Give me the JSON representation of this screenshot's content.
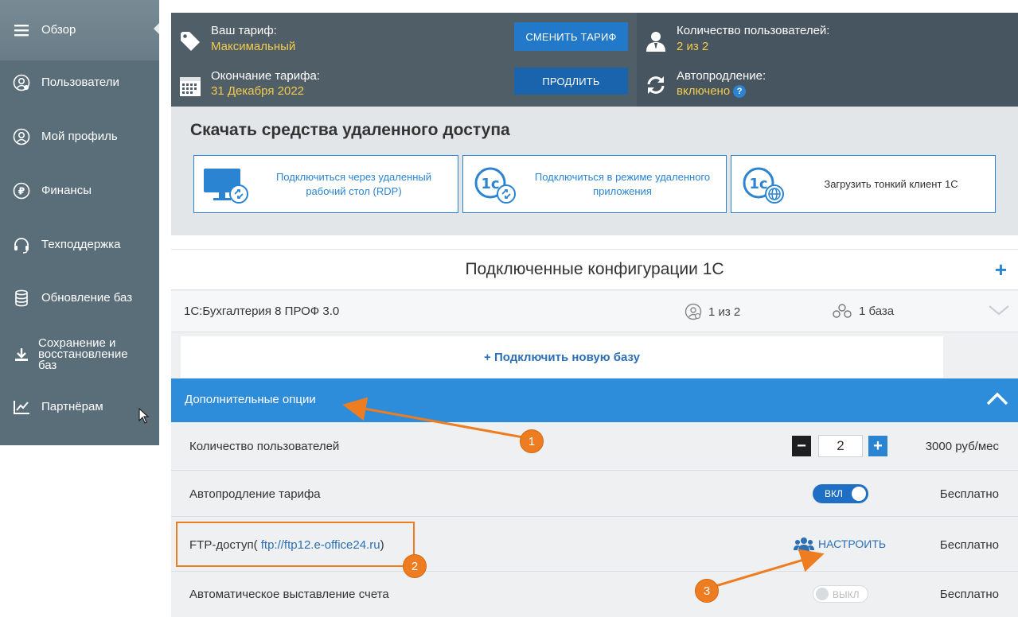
{
  "sidebar": {
    "items": [
      {
        "label": "Обзор",
        "icon": "menu-icon"
      },
      {
        "label": "Пользователи",
        "icon": "user-circle-icon"
      },
      {
        "label": "Мой профиль",
        "icon": "user-circle-icon"
      },
      {
        "label": "Финансы",
        "icon": "ruble-icon"
      },
      {
        "label": "Техподдержка",
        "icon": "headset-icon"
      },
      {
        "label": "Обновление баз",
        "icon": "database-icon"
      },
      {
        "label": "Сохранение и восстановление баз",
        "icon": "download-icon"
      },
      {
        "label": "Партнёрам",
        "icon": "chart-line-icon"
      }
    ]
  },
  "tariff": {
    "plan_label": "Ваш тариф:",
    "plan_value": "Максимальный",
    "change_button": "СМЕНИТЬ ТАРИФ",
    "end_label": "Окончание тарифа:",
    "end_value": "31 Декабря 2022",
    "extend_button": "ПРОДЛИТЬ"
  },
  "stats": {
    "users_label": "Количество пользователей:",
    "users_value": "2 из 2",
    "autorenew_label": "Автопродление:",
    "autorenew_value": "включено",
    "help_glyph": "?"
  },
  "download": {
    "title": "Скачать средства удаленного доступа",
    "cards": [
      {
        "label": "Подключиться через удаленный рабочий стол (RDP)",
        "icon": "monitor-rdp-icon"
      },
      {
        "label": "Подключиться в режиме удаленного приложения",
        "icon": "1c-remote-app-icon"
      },
      {
        "label": "Загрузить тонкий клиент 1С",
        "icon": "1c-web-client-icon"
      }
    ]
  },
  "configs": {
    "title": "Подключенные конфигурации 1С",
    "add_glyph": "+",
    "rows": [
      {
        "name": "1С:Бухгалтерия 8 ПРОФ 3.0",
        "users": "1 из 2",
        "bases": "1 база"
      }
    ],
    "connect_label": "+ Подключить новую базу"
  },
  "options": {
    "title": "Дополнительные опции",
    "rows": {
      "users": {
        "name": "Количество пользователей",
        "quantity": "2",
        "minus": "−",
        "plus": "+",
        "price": "3000 руб/мес"
      },
      "autorenew": {
        "name": "Автопродление тарифа",
        "toggle": "ВКЛ",
        "price": "Бесплатно"
      },
      "ftp": {
        "name_prefix": "FTP-доступ(",
        "url": "ftp://ftp12.e-office24.ru",
        "name_suffix": ")",
        "setup": "НАСТРОИТЬ",
        "price": "Бесплатно"
      },
      "invoice": {
        "name": "Автоматическое выставление счета",
        "toggle": "ВЫКЛ",
        "price": "Бесплатно"
      }
    }
  },
  "annotations": {
    "badge1": "1",
    "badge2": "2",
    "badge3": "3"
  },
  "colors": {
    "sidebar": "#5a6e7a",
    "accent_blue": "#2d8ddb",
    "accent_yellow": "#f3cc4c",
    "annotation_orange": "#ee7d21"
  }
}
